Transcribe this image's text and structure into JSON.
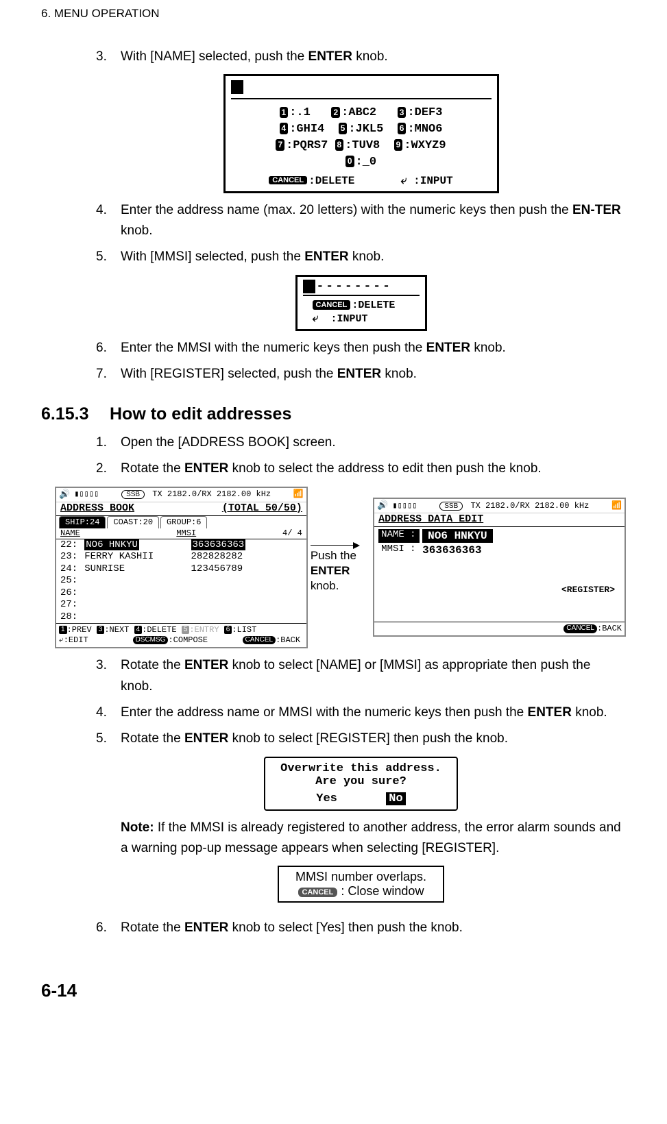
{
  "header": "6.  MENU OPERATION",
  "steps_a": {
    "s3": {
      "num": "3.",
      "text": "With [NAME] selected, push the <b>ENTER</b> knob."
    },
    "s4": {
      "num": "4.",
      "text": "Enter the address name (max. 20 letters) with the numeric keys then push the <b>EN-TER</b> knob."
    },
    "s5": {
      "num": "5.",
      "text": "With [MMSI] selected, push the <b>ENTER</b> knob."
    },
    "s6": {
      "num": "6.",
      "text": "Enter the MMSI with the numeric keys then push the <b>ENTER</b> knob."
    },
    "s7": {
      "num": "7.",
      "text": "With [REGISTER] selected, push the <b>ENTER</b> knob."
    }
  },
  "section": {
    "num": "6.15.3",
    "title": "How to edit addresses"
  },
  "steps_b": {
    "s1": {
      "num": "1.",
      "text": "Open the [ADDRESS BOOK] screen."
    },
    "s2": {
      "num": "2.",
      "text": "Rotate the <b>ENTER</b> knob to select the address to edit then push the knob."
    },
    "s3": {
      "num": "3.",
      "text": "Rotate the <b>ENTER</b> knob to select [NAME] or [MMSI] as appropriate then push the knob."
    },
    "s4": {
      "num": "4.",
      "text": "Enter the address name or MMSI with the numeric keys then push the <b>ENTER</b> knob."
    },
    "s5": {
      "num": "5.",
      "text": "Rotate the <b>ENTER</b> knob to select [REGISTER] then push the knob."
    },
    "note": "<b>Note:</b> If the MMSI is already registered to another address, the error alarm sounds and a warning pop-up message appears when selecting [REGISTER].",
    "s6": {
      "num": "6.",
      "text": "Rotate the <b>ENTER</b> knob to select [Yes] then push the knob."
    }
  },
  "fig1": {
    "keys": {
      "k1": ":.1",
      "k2": ":ABC2",
      "k3": ":DEF3",
      "k4": ":GHI4",
      "k5": ":JKL5",
      "k6": ":MNO6",
      "k7": ":PQRS7",
      "k8": ":TUV8",
      "k9": ":WXYZ9",
      "k0": ":_0"
    },
    "cancel_lbl": "CANCEL",
    "delete": ":DELETE",
    "input": ":INPUT"
  },
  "fig2": {
    "dashes": "--------",
    "cancel_lbl": "CANCEL",
    "delete": ":DELETE",
    "input": ":INPUT"
  },
  "arrow_label": "Push the <b>ENTER</b> knob.",
  "screen1": {
    "freq": "TX 2182.0/RX 2182.00 kHz",
    "ssb": "SSB",
    "title_left": "ADDRESS BOOK",
    "title_right": "(TOTAL  50/50)",
    "tabs": {
      "ship": "SHIP:24",
      "coast": "COAST:20",
      "group": "GROUP:6"
    },
    "col_name": "NAME",
    "col_mmsi": "MMSI",
    "col_page": "4/ 4",
    "rows": [
      {
        "n": "22:",
        "name": "NO6 HNKYU",
        "mmsi": "363636363",
        "sel": true
      },
      {
        "n": "23:",
        "name": "FERRY KASHII",
        "mmsi": "282828282"
      },
      {
        "n": "24:",
        "name": "SUNRISE",
        "mmsi": "123456789"
      },
      {
        "n": "25:",
        "name": "",
        "mmsi": ""
      },
      {
        "n": "26:",
        "name": "",
        "mmsi": ""
      },
      {
        "n": "27:",
        "name": "",
        "mmsi": ""
      },
      {
        "n": "28:",
        "name": "",
        "mmsi": ""
      }
    ],
    "foot": {
      "prev": ":PREV",
      "next": ":NEXT",
      "delete": ":DELETE",
      "entry": ":ENTRY",
      "list": ":LIST",
      "edit": ":EDIT",
      "compose": ":COMPOSE",
      "back": ":BACK",
      "k1": "1",
      "k3": "3",
      "k4": "4",
      "k5": "5",
      "k6": "6",
      "enter": "↵",
      "dscmsg": "DSCMSG",
      "cancel": "CANCEL"
    }
  },
  "screen2": {
    "freq": "TX 2182.0/RX 2182.00 kHz",
    "ssb": "SSB",
    "title": "ADDRESS DATA EDIT",
    "name_lbl": "NAME :",
    "name_val": "NO6 HNKYU",
    "mmsi_lbl": "MMSI :",
    "mmsi_val": "363636363",
    "register": "<REGISTER>",
    "back": ":BACK",
    "cancel": "CANCEL"
  },
  "confirm": {
    "line1": "Overwrite this address.",
    "line2": "Are you sure?",
    "yes": "Yes",
    "no": "No"
  },
  "warn": {
    "line1": "MMSI number overlaps.",
    "cancel": "CANCEL",
    "close": ": Close window"
  },
  "page_num": "6-14"
}
